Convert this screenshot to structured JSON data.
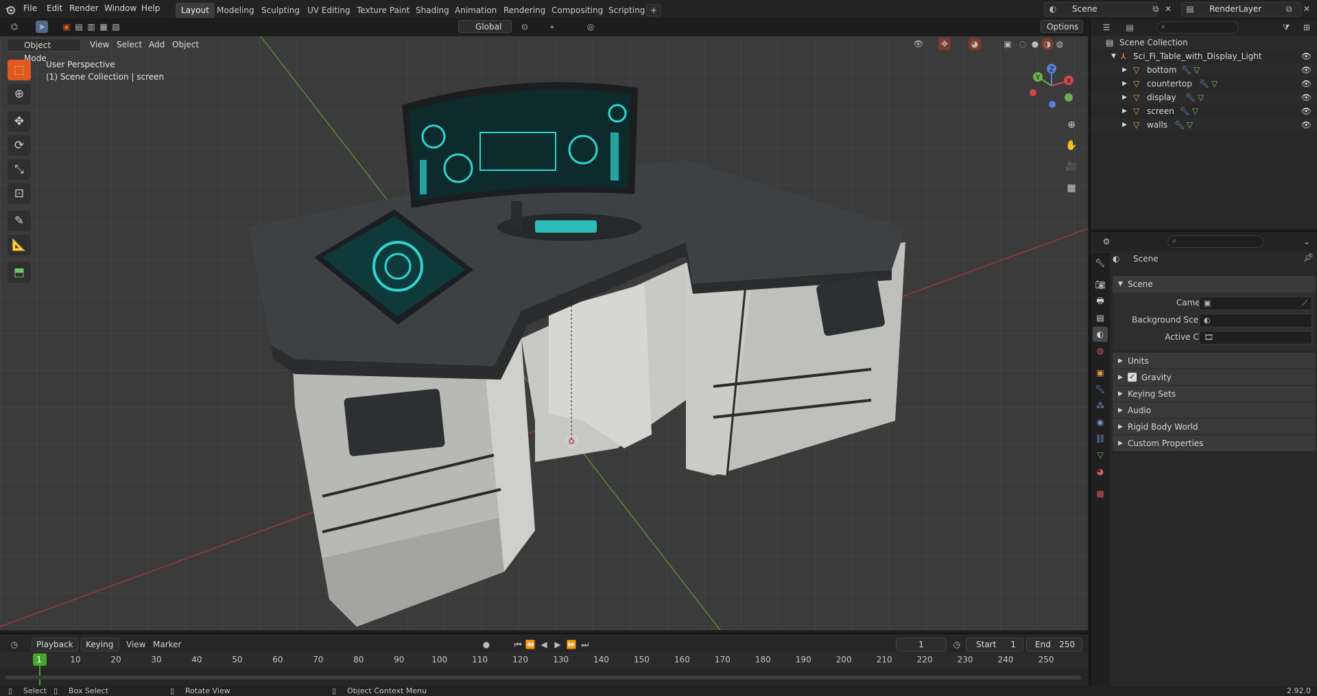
{
  "topbar": {
    "menus": [
      "File",
      "Edit",
      "Render",
      "Window",
      "Help"
    ],
    "workspaces": [
      "Layout",
      "Modeling",
      "Sculpting",
      "UV Editing",
      "Texture Paint",
      "Shading",
      "Animation",
      "Rendering",
      "Compositing",
      "Scripting"
    ],
    "active_workspace": "Layout",
    "add_workspace": "+",
    "scene_name": "Scene",
    "view_layer": "RenderLayer"
  },
  "viewport": {
    "mode": "Object Mode",
    "menus": [
      "View",
      "Select",
      "Add",
      "Object"
    ],
    "transform_orientation": "Global",
    "options_label": "Options",
    "perspective_label": "User Perspective",
    "collection_label": "(1) Scene Collection | screen",
    "gizmo_axes": {
      "x": "X",
      "y": "Y",
      "z": "Z"
    }
  },
  "outliner": {
    "root": "Scene Collection",
    "collection": "Sci_Fi_Table_with_Display_Light",
    "objects": [
      "bottom",
      "countertop",
      "display",
      "screen",
      "walls"
    ]
  },
  "properties": {
    "context_title": "Scene",
    "panel_title": "Scene",
    "camera_label": "Camera",
    "background_scene_label": "Background Scene",
    "active_clip_label": "Active Clip",
    "subpanels": [
      "Units",
      "Gravity",
      "Keying Sets",
      "Audio",
      "Rigid Body World",
      "Custom Properties"
    ],
    "gravity_checked": true
  },
  "timeline": {
    "menus": [
      "Playback",
      "Keying",
      "View",
      "Marker"
    ],
    "current_frame": "1",
    "start_label": "Start",
    "start_value": "1",
    "end_label": "End",
    "end_value": "250",
    "ticks": [
      "1",
      "10",
      "20",
      "30",
      "40",
      "50",
      "60",
      "70",
      "80",
      "90",
      "100",
      "110",
      "120",
      "130",
      "140",
      "150",
      "160",
      "170",
      "180",
      "190",
      "200",
      "210",
      "220",
      "230",
      "240",
      "250"
    ]
  },
  "statusbar": {
    "select": "Select",
    "box_select": "Box Select",
    "rotate_view": "Rotate View",
    "context_menu": "Object Context Menu",
    "version": "2.92.0"
  },
  "colors": {
    "accent_blue": "#4f6a8a",
    "active_tool_orange": "#e05a20",
    "object_orange": "#e8a04a",
    "frame_green": "#4aa52e",
    "display_cyan": "#2fd6d0"
  }
}
